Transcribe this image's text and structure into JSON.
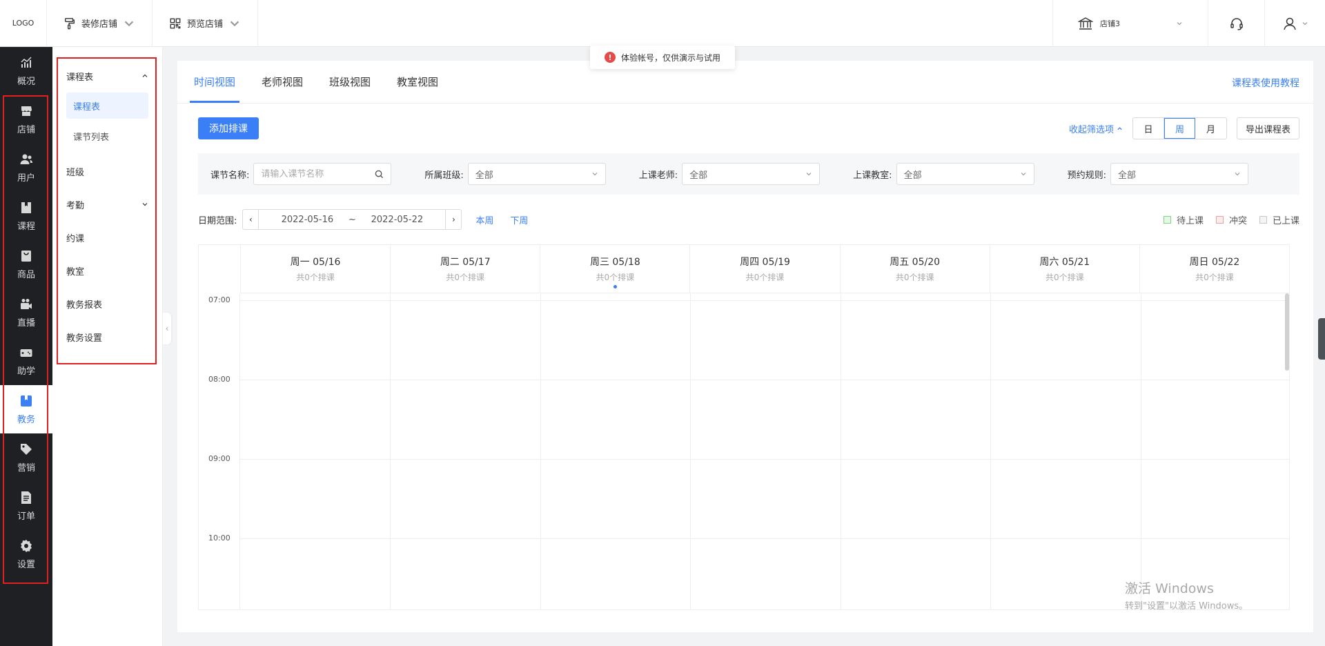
{
  "topbar": {
    "logo": "LOGO",
    "decorate_store": "装修店铺",
    "preview_store": "预览店铺",
    "store_name": "店铺3"
  },
  "notice": {
    "text": "体验帐号，仅供演示与试用"
  },
  "leftnav": {
    "items": [
      {
        "label": "概况",
        "icon": "chart-line-icon"
      },
      {
        "label": "店铺",
        "icon": "store-icon"
      },
      {
        "label": "用户",
        "icon": "users-icon"
      },
      {
        "label": "课程",
        "icon": "book-icon"
      },
      {
        "label": "商品",
        "icon": "bag-icon"
      },
      {
        "label": "直播",
        "icon": "video-icon"
      },
      {
        "label": "助学",
        "icon": "gamepad-icon"
      },
      {
        "label": "教务",
        "icon": "bookmark-icon"
      },
      {
        "label": "营销",
        "icon": "tag-icon"
      },
      {
        "label": "订单",
        "icon": "document-icon"
      },
      {
        "label": "设置",
        "icon": "gear-icon"
      }
    ],
    "active_index": 7
  },
  "subnav": {
    "group_schedule": "课程表",
    "child_schedule": "课程表",
    "child_lessons": "课节列表",
    "class": "班级",
    "attendance": "考勤",
    "booking": "约课",
    "classroom": "教室",
    "report": "教务报表",
    "settings": "教务设置"
  },
  "tabs": {
    "time_view": "时间视图",
    "teacher_view": "老师视图",
    "class_view": "班级视图",
    "classroom_view": "教室视图"
  },
  "tutorial_link": "课程表使用教程",
  "toolbar": {
    "add_schedule": "添加排课",
    "collapse_filter": "收起筛选项",
    "view_day": "日",
    "view_week": "周",
    "view_month": "月",
    "export": "导出课程表"
  },
  "filters": {
    "lesson_name_label": "课节名称:",
    "lesson_name_placeholder": "请输入课节名称",
    "class_label": "所属班级:",
    "class_value": "全部",
    "teacher_label": "上课老师:",
    "teacher_value": "全部",
    "room_label": "上课教室:",
    "room_value": "全部",
    "rule_label": "预约规则:",
    "rule_value": "全部"
  },
  "date_range": {
    "label": "日期范围:",
    "start": "2022-05-16",
    "separator": "~",
    "end": "2022-05-22",
    "this_week": "本周",
    "next_week": "下周"
  },
  "legend": {
    "pending": "待上课",
    "pending_color": "#7ed67e",
    "conflict": "冲突",
    "conflict_color": "#f0a0a0",
    "done": "已上课",
    "done_color": "#c8c8c8"
  },
  "calendar": {
    "days": [
      {
        "title": "周一 05/16",
        "count": "共0个排课"
      },
      {
        "title": "周二 05/17",
        "count": "共0个排课"
      },
      {
        "title": "周三 05/18",
        "count": "共0个排课",
        "today": true
      },
      {
        "title": "周四 05/19",
        "count": "共0个排课"
      },
      {
        "title": "周五 05/20",
        "count": "共0个排课"
      },
      {
        "title": "周六 05/21",
        "count": "共0个排课"
      },
      {
        "title": "周日 05/22",
        "count": "共0个排课"
      }
    ],
    "times": [
      "07:00",
      "08:00",
      "09:00",
      "10:00"
    ]
  },
  "watermark": {
    "line1": "激活 Windows",
    "line2": "转到\"设置\"以激活 Windows。"
  },
  "colors": {
    "accent": "#3a7ff6",
    "nav_bg": "#1f2024",
    "highlight_box": "#e02020"
  }
}
